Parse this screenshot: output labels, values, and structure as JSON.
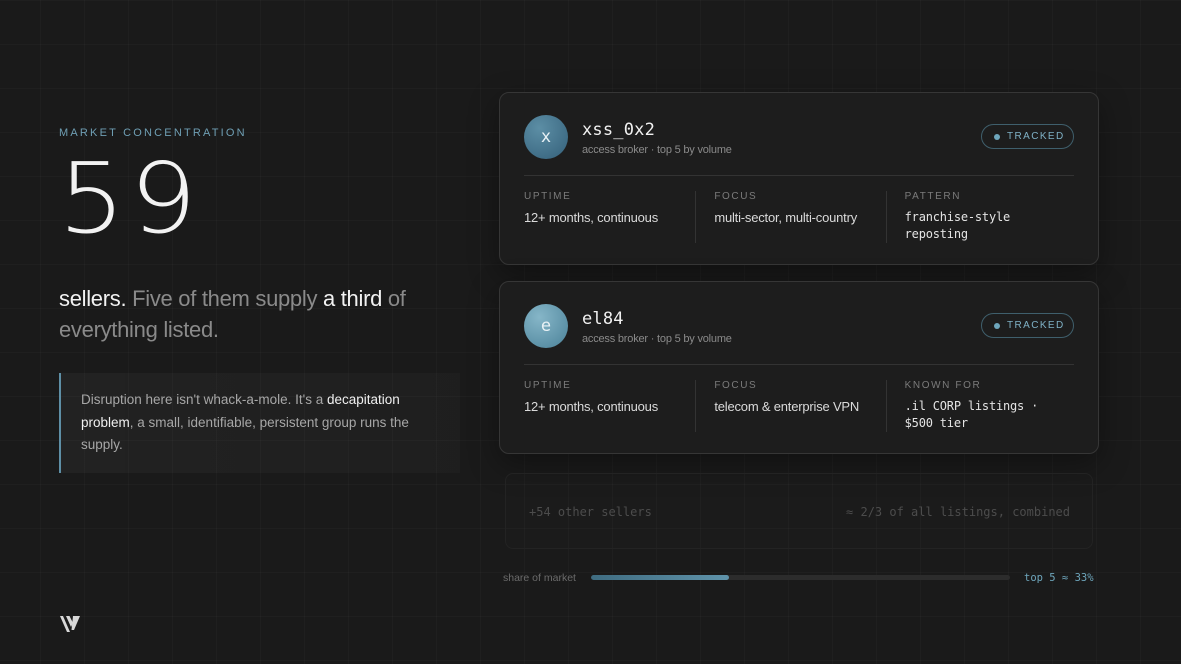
{
  "left": {
    "eyebrow": "MARKET CONCENTRATION",
    "number": "59",
    "headline": {
      "p1": "sellers.",
      "p2": " Five of them supply ",
      "p3": "a third",
      "p4": " of everything listed."
    },
    "quote": {
      "p1": "Disruption here isn't whack-a-mole. It's a ",
      "p2": "decapitation problem",
      "p3": ", a small, identifiable, persistent group runs the supply."
    }
  },
  "cards": [
    {
      "initial": "x",
      "handle": "xss_0x2",
      "subtitle": "access broker · top 5 by volume",
      "badge": "TRACKED",
      "cols": [
        {
          "label": "UPTIME",
          "value": "12+ months, continuous"
        },
        {
          "label": "FOCUS",
          "value": "multi-sector, multi-country"
        },
        {
          "label": "PATTERN",
          "value": "franchise-style reposting"
        }
      ]
    },
    {
      "initial": "e",
      "handle": "el84",
      "subtitle": "access broker · top 5 by volume",
      "badge": "TRACKED",
      "cols": [
        {
          "label": "UPTIME",
          "value": "12+ months, continuous"
        },
        {
          "label": "FOCUS",
          "value": "telecom & enterprise VPN"
        },
        {
          "label": "KNOWN FOR",
          "value": ".il CORP listings · $500 tier"
        }
      ]
    }
  ],
  "others": {
    "left": "+54 other sellers",
    "right": "≈ 2/3 of all listings, combined"
  },
  "share": {
    "label": "share of market",
    "value_text": "top 5 ≈ 33%",
    "fraction": 0.33
  },
  "colors": {
    "accent": "#6ea6bc",
    "background": "#1a1a1a"
  },
  "icons": {
    "logo": "v-logo-icon",
    "badge_dot": "dot-icon"
  }
}
